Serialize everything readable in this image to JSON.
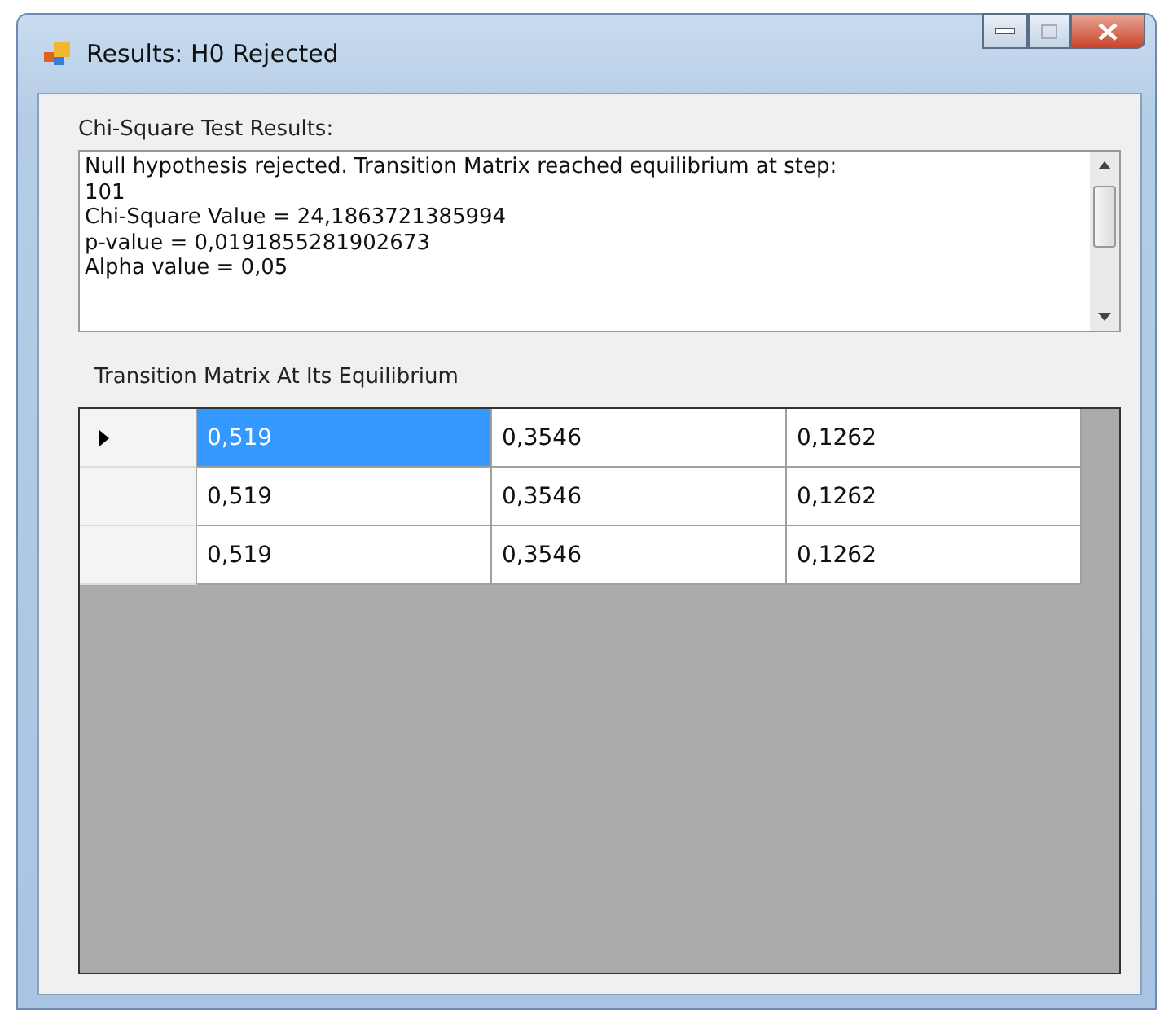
{
  "window": {
    "title": "Results: H0 Rejected"
  },
  "results": {
    "label": "Chi-Square Test Results:",
    "lines": [
      "Null hypothesis rejected. Transition Matrix reached equilibrium at step:",
      "101",
      "Chi-Square Value = 24,1863721385994",
      "p-value = 0,0191855281902673",
      "Alpha value = 0,05"
    ]
  },
  "matrix": {
    "label": "Transition Matrix At Its Equilibrium",
    "rows": [
      {
        "current": true,
        "cells": [
          {
            "text": "0,519",
            "selected": true
          },
          {
            "text": "0,3546",
            "selected": false
          },
          {
            "text": "0,1262",
            "selected": false
          }
        ]
      },
      {
        "current": false,
        "cells": [
          {
            "text": "0,519",
            "selected": false
          },
          {
            "text": "0,3546",
            "selected": false
          },
          {
            "text": "0,1262",
            "selected": false
          }
        ]
      },
      {
        "current": false,
        "cells": [
          {
            "text": "0,519",
            "selected": false
          },
          {
            "text": "0,3546",
            "selected": false
          },
          {
            "text": "0,1262",
            "selected": false
          }
        ]
      }
    ]
  }
}
